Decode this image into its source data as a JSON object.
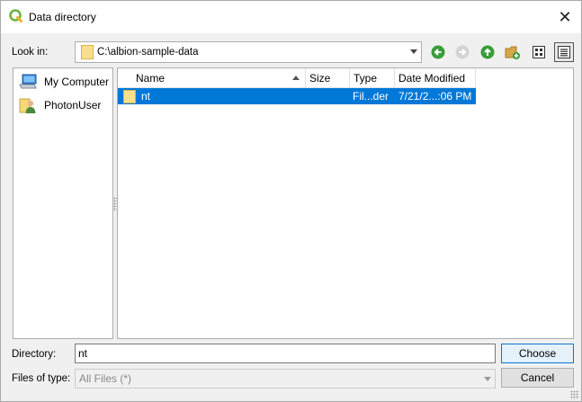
{
  "window": {
    "title": "Data directory"
  },
  "look_in": {
    "label": "Look in:",
    "path": "C:\\albion-sample-data"
  },
  "toolbar": {
    "back_icon": "back-arrow-icon",
    "forward_icon": "forward-arrow-icon",
    "parent_icon": "up-arrow-icon",
    "new_folder_icon": "new-folder-icon",
    "list_view_icon": "list-view-icon",
    "detail_view_icon": "detail-view-icon"
  },
  "sidebar": {
    "items": [
      {
        "label": "My Computer",
        "icon": "computer-icon"
      },
      {
        "label": "PhotonUser",
        "icon": "user-folder-icon"
      }
    ]
  },
  "file_list": {
    "columns": [
      "Name",
      "Size",
      "Type",
      "Date Modified"
    ],
    "rows": [
      {
        "name": "nt",
        "size": "",
        "type": "Fil...der",
        "modified": "7/21/2...:06 PM",
        "selected": true
      }
    ]
  },
  "directory": {
    "label": "Directory:",
    "value": "nt"
  },
  "files_of_type": {
    "label": "Files of type:",
    "value": "All Files (*)"
  },
  "buttons": {
    "choose": "Choose",
    "cancel": "Cancel"
  },
  "colors": {
    "selection": "#0078d7",
    "green_nav": "#3a9c3a",
    "folder": "#f5d77a"
  }
}
